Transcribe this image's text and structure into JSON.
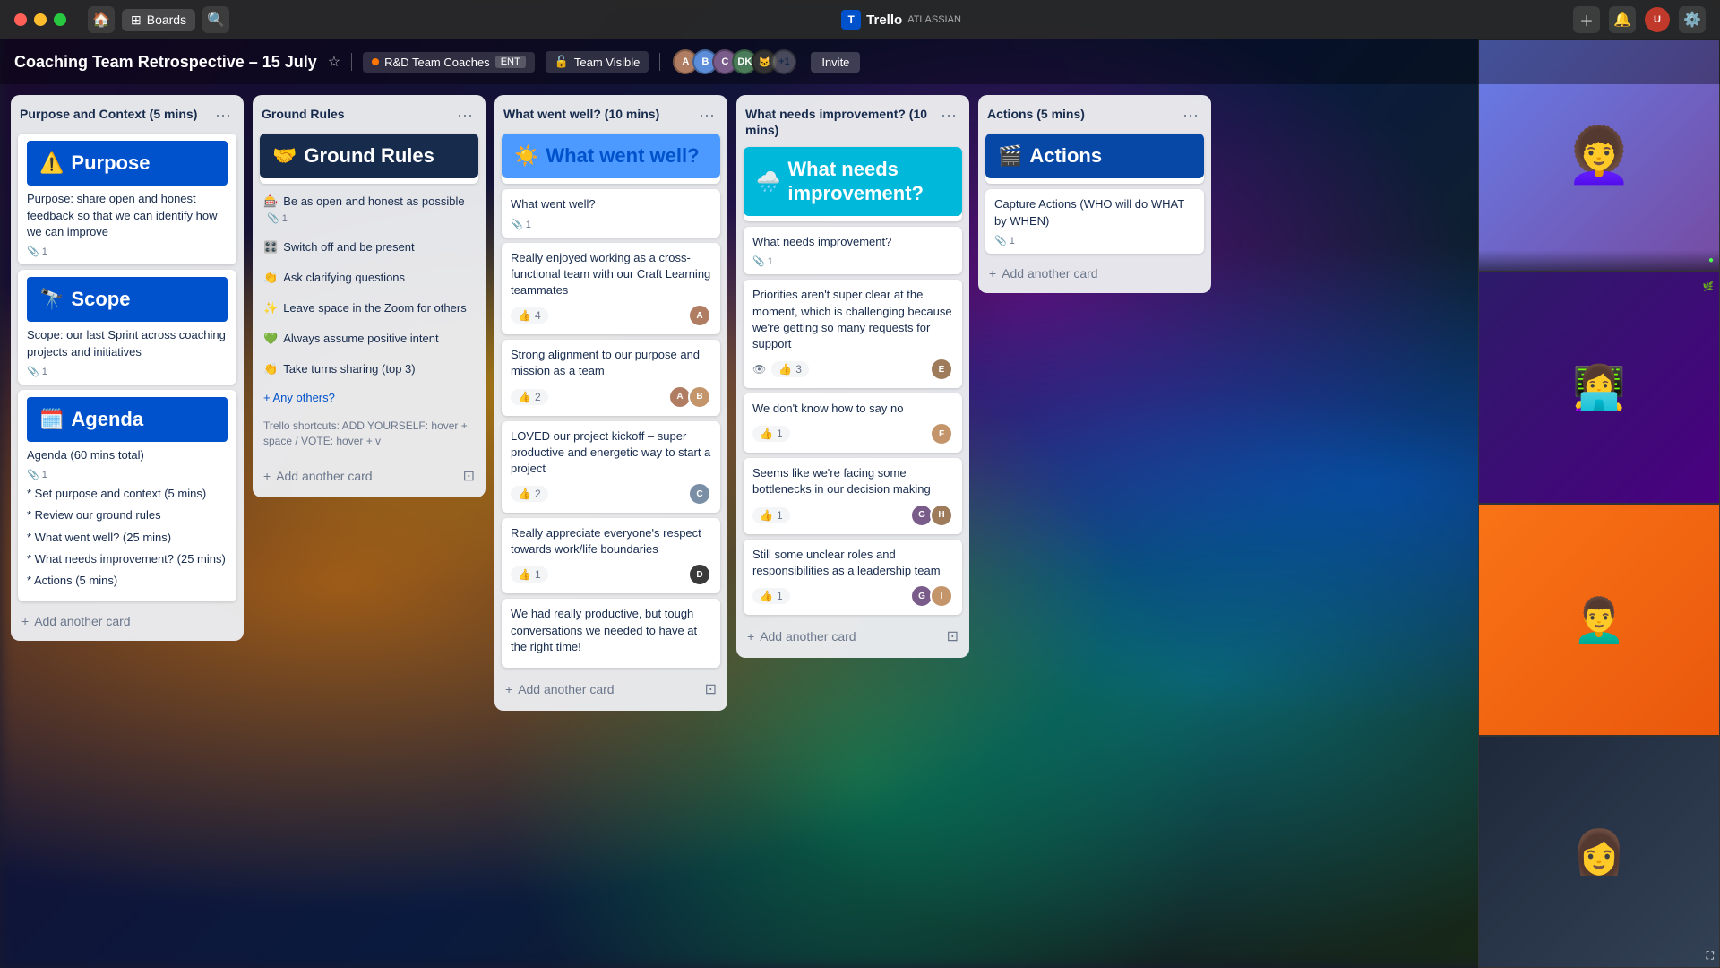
{
  "titlebar": {
    "boards_label": "Boards",
    "trello_label": "Trello",
    "atlassian_label": "ATLASSIAN"
  },
  "board": {
    "title": "Coaching Team Retrospective – 15 July",
    "workspace_tag": "R&D Team Coaches",
    "workspace_ent": "ENT",
    "visibility_tag": "Team Visible",
    "invite_label": "Invite",
    "plus_count": "+1"
  },
  "columns": [
    {
      "id": "purpose",
      "title": "Purpose and Context (5 mins)",
      "cards": [
        {
          "type": "banner",
          "banner_class": "blue",
          "emoji": "⚠️",
          "title": "Purpose",
          "body": "Purpose: share open and honest feedback so that we can identify how we can improve",
          "attachments": 1
        },
        {
          "type": "banner",
          "banner_class": "blue",
          "emoji": "🔭",
          "title": "Scope",
          "body": "Scope: our last Sprint across coaching projects and initiatives",
          "attachments": 1
        },
        {
          "type": "banner",
          "banner_class": "blue",
          "emoji": "🗓️",
          "title": "Agenda",
          "body": "Agenda (60 mins total)",
          "attachments": 1,
          "list_items": [
            "* Set purpose and context (5 mins)",
            "* Review our ground rules",
            "* What went well? (25 mins)",
            "* What needs improvement? (25 mins)",
            "* Actions (5 mins)"
          ]
        }
      ],
      "add_label": "+ Add another card"
    },
    {
      "id": "ground-rules",
      "title": "Ground Rules",
      "banner": {
        "banner_class": "dark",
        "emoji": "🤝",
        "title": "Ground Rules"
      },
      "items": [
        {
          "emoji": "🎰",
          "text": "Be as open and honest as possible",
          "attach": 1
        },
        {
          "emoji": "🎛️",
          "text": "Switch off and be present",
          "attach": null
        },
        {
          "emoji": "👏",
          "text": "Ask clarifying questions",
          "attach": null
        },
        {
          "emoji": "✨",
          "text": "Leave space in the Zoom for others",
          "attach": null
        },
        {
          "emoji": "💚",
          "text": "Always assume positive intent",
          "attach": null
        },
        {
          "emoji": "👏",
          "text": "Take turns sharing (top 3)",
          "attach": null
        }
      ],
      "any_others": "+ Any others?",
      "shortcut_text": "Trello shortcuts: ADD YOURSELF: hover + space / VOTE: hover + v",
      "add_label": "+ Add another card"
    },
    {
      "id": "went-well",
      "title": "What went well? (10 mins)",
      "banner": {
        "banner_class": "blue-light",
        "emoji": "☀️",
        "title": "What went well?"
      },
      "header_card": {
        "text": "What went well?",
        "attach": 1
      },
      "cards": [
        {
          "text": "Really enjoyed working as a cross-functional team with our Craft Learning teammates",
          "likes": 4,
          "liked": false,
          "avatar_color": "#b07d62"
        },
        {
          "text": "Strong alignment to our purpose and mission as a team",
          "likes": 2,
          "liked": false,
          "avatars": [
            "#b07d62",
            "#c4956a"
          ]
        },
        {
          "text": "LOVED our project kickoff – super productive and energetic way to start a project",
          "likes": 2,
          "liked": false,
          "avatar_color": "#7a8fa6"
        },
        {
          "text": "Really appreciate everyone's respect towards work/life boundaries",
          "likes": 1,
          "liked": false,
          "avatar_color": "#3a3a3a"
        },
        {
          "text": "We had really productive, but tough conversations we needed to have at the right time!",
          "likes": null
        }
      ],
      "add_label": "+ Add another card"
    },
    {
      "id": "needs-improvement",
      "title": "What needs improvement? (10 mins)",
      "banner": {
        "banner_class": "teal",
        "emoji": "🌧️",
        "title": "What needs improvement?"
      },
      "header_card": {
        "text": "What needs improvement?",
        "attach": 1
      },
      "cards": [
        {
          "text": "Priorities aren't super clear at the moment, which is challenging because we're getting so many requests for support",
          "likes": 3,
          "liked": false,
          "has_eye": true,
          "avatar_color": "#9e7b5a"
        },
        {
          "text": "We don't know how to say no",
          "likes": 1,
          "liked": false,
          "avatar_color": "#c4956a"
        },
        {
          "text": "Seems like we're facing some bottlenecks in our decision making",
          "likes": 1,
          "liked": false,
          "avatars": [
            "#7a5c8a",
            "#9e7b5a"
          ]
        },
        {
          "text": "Still some unclear roles and responsibilities as a leadership team",
          "likes": 1,
          "liked": false,
          "avatars": [
            "#7a5c8a",
            "#c4956a"
          ]
        }
      ],
      "add_label": "+ Add another card"
    },
    {
      "id": "actions",
      "title": "Actions (5 mins)",
      "banner": {
        "banner_class": "navy",
        "emoji": "🎬",
        "title": "Actions"
      },
      "cards": [
        {
          "text": "Capture Actions (WHO will do WHAT by WHEN)",
          "attach": 1
        }
      ],
      "add_label": "+ Add another card"
    }
  ],
  "video_people": [
    {
      "bg": "bg-purple",
      "emoji": "😊",
      "label": ""
    },
    {
      "bg": "bg-blue",
      "emoji": "🧑‍💻",
      "label": ""
    },
    {
      "bg": "bg-orange",
      "emoji": "👨",
      "label": ""
    },
    {
      "bg": "bg-dark",
      "emoji": "👩",
      "label": ""
    }
  ]
}
